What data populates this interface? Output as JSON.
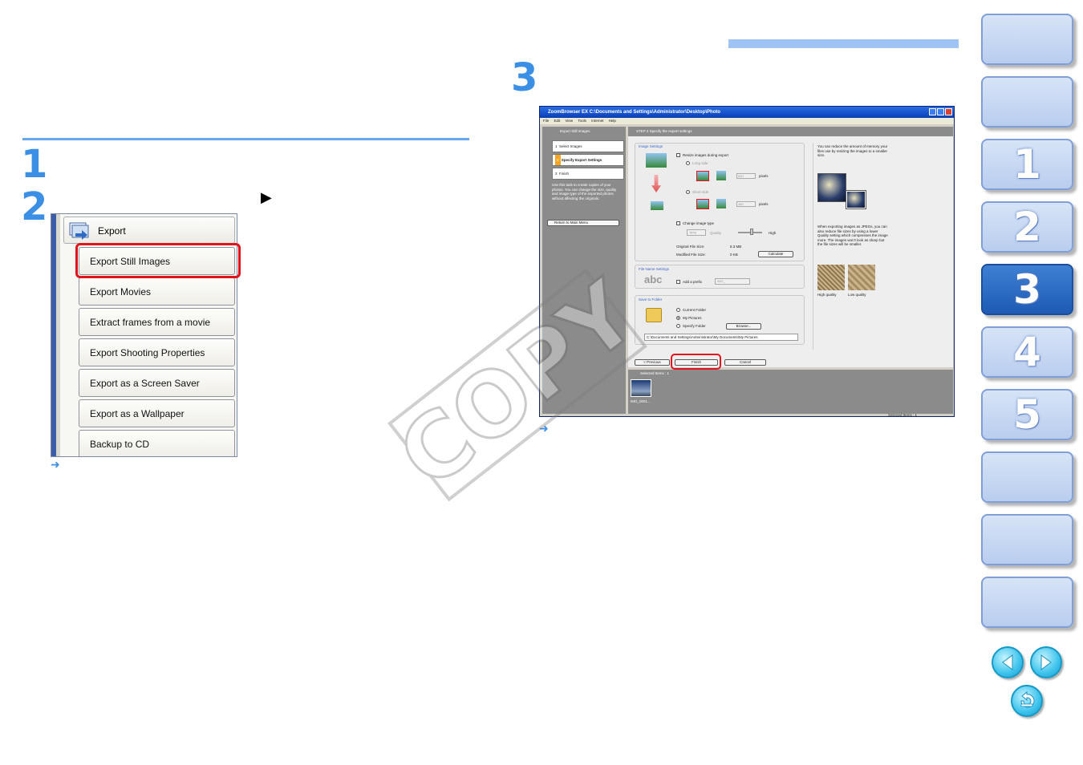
{
  "left": {
    "step1": "1",
    "step2": "2",
    "arrow_glyph": "▶",
    "menu": {
      "header": "Export",
      "items": [
        "Export Still Images",
        "Export Movies",
        "Extract frames from a movie",
        "Export Shooting Properties",
        "Export as a Screen Saver",
        "Export as a Wallpaper",
        "Backup to CD"
      ]
    },
    "result_arrow": "➜"
  },
  "right": {
    "step3": "3",
    "result_arrow": "➜",
    "window": {
      "title": "ZoomBrowser EX    C:\\Documents and Settings\\Administrator\\Desktop\\Photo",
      "menu": "File Edit View Tools Internet Help",
      "left_header": "Export Still Images",
      "steps": [
        {
          "num": "1",
          "label": "Select Images"
        },
        {
          "num": "2",
          "label": "Specify Export Settings"
        },
        {
          "num": "3",
          "label": "Finish"
        }
      ],
      "help_text": "Use this task to create copies of your photos. You can change the size, quality and image type of the exported photos without affecting the originals.",
      "return_btn": "Return to Main Menu",
      "step_header": "STEP 2 Specify the export settings",
      "image_settings_label": "Image Settings",
      "resize_label": "Resize images during export",
      "long_side": "Long side",
      "short_side": "Short side",
      "long_value": "640",
      "short_value": "480",
      "pixels": "pixels",
      "change_type_label": "Change image type",
      "type_value": "Jpeg",
      "quality_label": "Quality",
      "high_label": "High",
      "orig_size_label": "Original File Size:",
      "orig_size_value": "6.3 MB",
      "mod_size_label": "Modified File Size:",
      "mod_size_value": "0 KB",
      "calculate_btn": "Calculate",
      "file_name_label": "File Name Settings",
      "abc": "abc",
      "add_prefix": "Add a prefix",
      "prefix_value": "IMG_",
      "save_folder_label": "Save to Folder",
      "current_folder": "Current Folder",
      "my_pictures": "My Pictures",
      "specify_folder": "Specify Folder",
      "browse_btn": "Browse...",
      "path": "C:\\Documents and Settings\\Administrator\\My Documents\\My Pictures",
      "previous_btn": "< Previous",
      "finish_btn": "Finish",
      "cancel_btn": "Cancel",
      "selected_items": "Selected Items : 1",
      "thumb_label": "IMG_0001...",
      "status": "Selected Items : 1",
      "tip1": "You can reduce the amount of memory your files use by resizing the images to a smaller size.",
      "tip2": "When exporting images as JPEGs, you can also reduce file sizes by using a lower Quality setting which compresses the image more. The images won't look as sharp but the file sizes will be smaller.",
      "high_quality": "High quality",
      "low_quality": "Low quality"
    }
  },
  "watermark": "COPY",
  "sidebar": {
    "tabs": [
      "",
      "",
      "1",
      "2",
      "3",
      "4",
      "5",
      "",
      "",
      ""
    ],
    "active_tab": "3"
  },
  "colors": {
    "accent": "#3b8fe4",
    "highlight": "#e0141c",
    "tab_active": "#1d5bb5"
  }
}
